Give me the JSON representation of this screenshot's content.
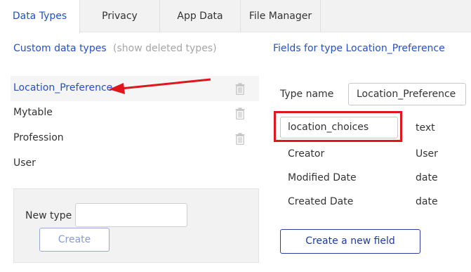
{
  "tabs": [
    {
      "label": "Data Types",
      "active": true
    },
    {
      "label": "Privacy",
      "active": false
    },
    {
      "label": "App Data",
      "active": false
    },
    {
      "label": "File Manager",
      "active": false
    }
  ],
  "left": {
    "title": "Custom data types",
    "show_deleted": "(show deleted types)",
    "types": [
      {
        "label": "Location_Preference",
        "selected": true,
        "deletable": true
      },
      {
        "label": "Mytable",
        "selected": false,
        "deletable": true
      },
      {
        "label": "Profession",
        "selected": false,
        "deletable": true
      },
      {
        "label": "User",
        "selected": false,
        "deletable": false
      }
    ],
    "new_type_label": "New type",
    "new_type_value": "",
    "create_label": "Create"
  },
  "right": {
    "title": "Fields for type Location_Preference",
    "type_name_label": "Type name",
    "type_name_value": "Location_Preference",
    "fields": [
      {
        "name": "location_choices",
        "type": "text",
        "editing": true
      },
      {
        "name": "Creator",
        "type": "User"
      },
      {
        "name": "Modified Date",
        "type": "date"
      },
      {
        "name": "Created Date",
        "type": "date"
      }
    ],
    "create_field_label": "Create a new field"
  },
  "colors": {
    "accent": "#2450c8",
    "highlight": "#e0161c",
    "muted": "#a6a6a6"
  },
  "icons": {
    "trash": "trash-icon",
    "annotation_arrow": "red-arrow"
  }
}
